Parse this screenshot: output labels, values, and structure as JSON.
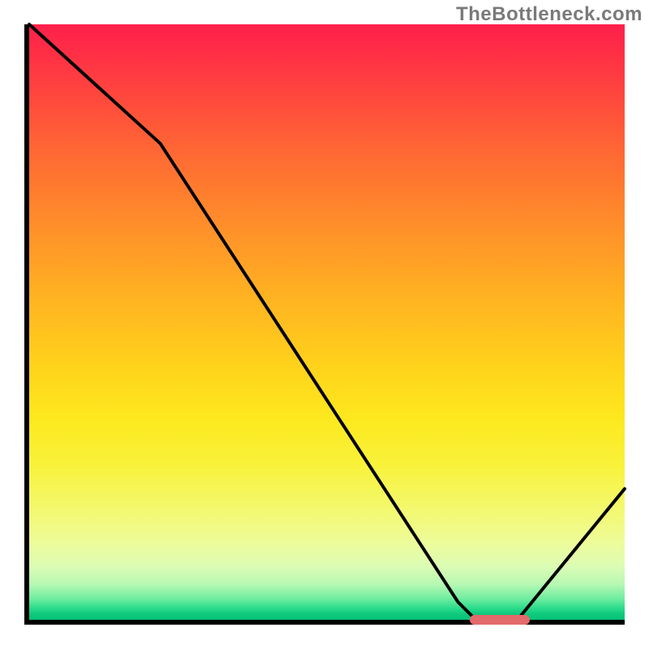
{
  "watermark": "TheBottleneck.com",
  "plot": {
    "inner_w": 734,
    "inner_h": 734
  },
  "chart_data": {
    "type": "line",
    "title": "",
    "xlabel": "",
    "ylabel": "",
    "xlim": [
      0,
      100
    ],
    "ylim": [
      0,
      100
    ],
    "x": [
      0,
      22,
      72,
      75,
      82,
      100
    ],
    "values": [
      100,
      80,
      3,
      0,
      0,
      22
    ],
    "minimum_band": {
      "x_start": 74,
      "x_end": 84,
      "y": 0
    },
    "background_gradient": {
      "top": "#ff1f4b",
      "mid": "#ffd11c",
      "bottom": "#05c177"
    }
  }
}
